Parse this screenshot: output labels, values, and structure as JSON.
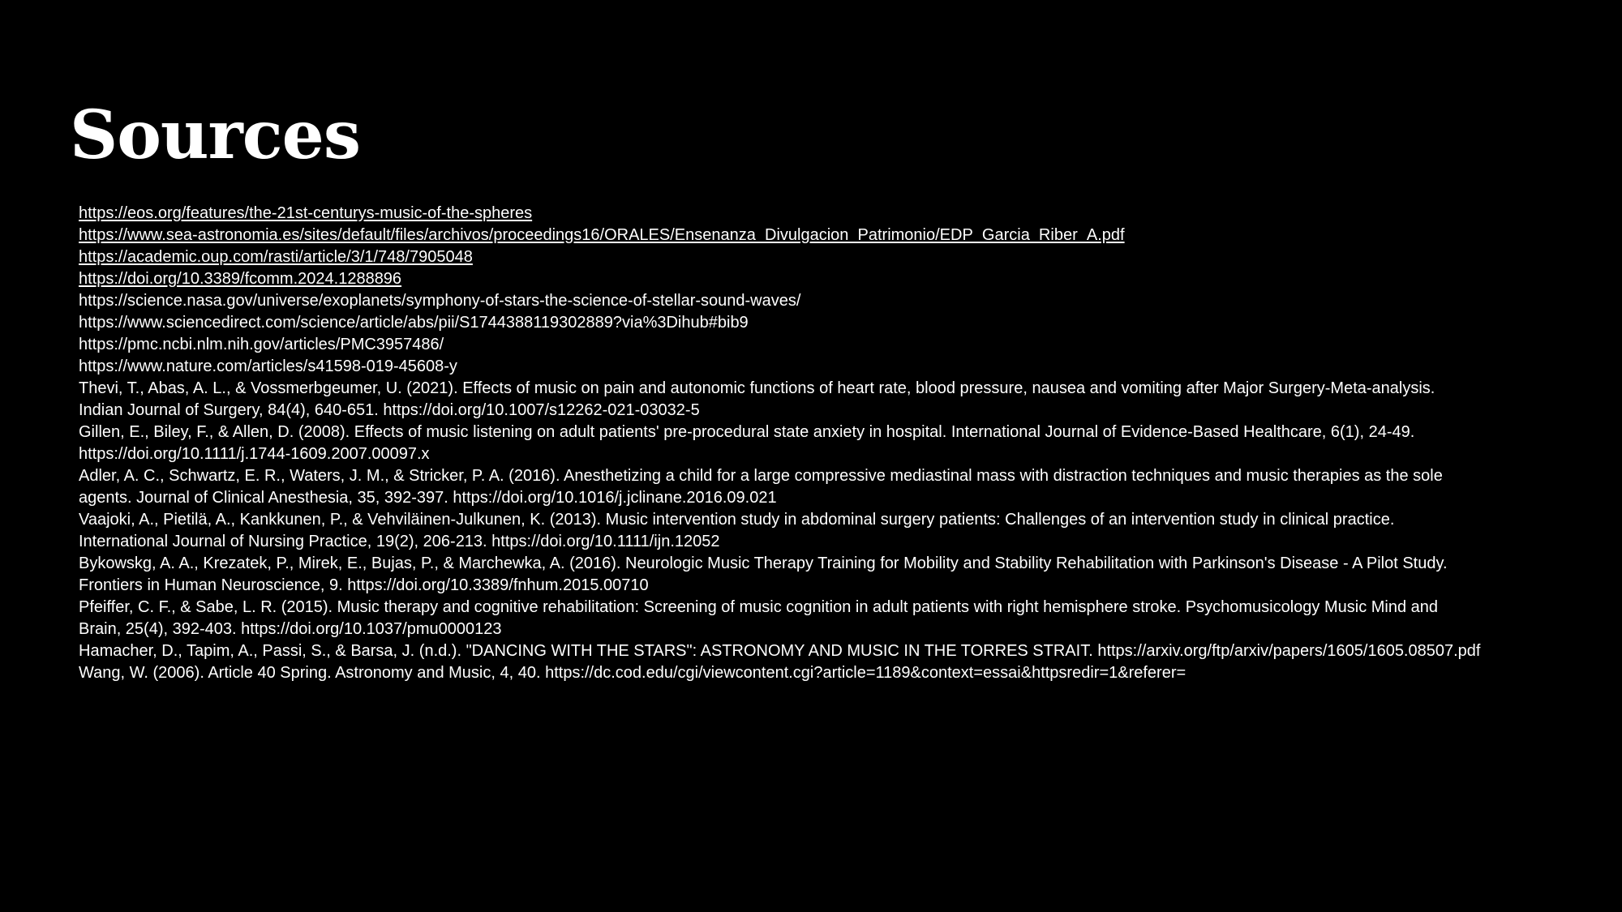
{
  "title": "Sources",
  "links": [
    "https://eos.org/features/the-21st-centurys-music-of-the-spheres",
    "https://www.sea-astronomia.es/sites/default/files/archivos/proceedings16/ORALES/Ensenanza_Divulgacion_Patrimonio/EDP_Garcia_Riber_A.pdf",
    "https://academic.oup.com/rasti/article/3/1/748/7905048",
    "https://doi.org/10.3389/fcomm.2024.1288896"
  ],
  "plain_urls": [
    "https://science.nasa.gov/universe/exoplanets/symphony-of-stars-the-science-of-stellar-sound-waves/",
    "https://www.sciencedirect.com/science/article/abs/pii/S1744388119302889?via%3Dihub#bib9",
    "https://pmc.ncbi.nlm.nih.gov/articles/PMC3957486/",
    "https://www.nature.com/articles/s41598-019-45608-y"
  ],
  "citations": [
    {
      "line1": "Thevi, T., Abas, A. L., & Vossmerbgeumer, U. (2021). Effects of music on pain and autonomic functions of heart rate, blood pressure, nausea and vomiting after Major Surgery-Meta-analysis.",
      "line2": "Indian Journal of Surgery, 84(4), 640-651. https://doi.org/10.1007/s12262-021-03032-5"
    },
    {
      "line1": "Gillen, E., Biley, F., & Allen, D. (2008). Effects of music listening on adult patients' pre-procedural state anxiety in hospital. International Journal of Evidence-Based Healthcare, 6(1), 24-49.",
      "line2": "https://doi.org/10.1111/j.1744-1609.2007.00097.x"
    },
    {
      "line1": "Adler, A. C., Schwartz, E. R., Waters, J. M., & Stricker, P. A. (2016). Anesthetizing a child for a large compressive mediastinal mass with distraction techniques and music therapies as the sole",
      "line2": "agents. Journal of Clinical Anesthesia, 35, 392-397. https://doi.org/10.1016/j.jclinane.2016.09.021"
    },
    {
      "line1": "Vaajoki, A., Pietilä, A., Kankkunen, P., & Vehviläinen-Julkunen, K. (2013). Music intervention study in abdominal surgery patients: Challenges of an intervention study in clinical practice.",
      "line2": "International Journal of Nursing Practice, 19(2), 206-213. https://doi.org/10.1111/ijn.12052"
    },
    {
      "line1": "Bykowskg, A. A., Krezatek, P., Mirek, E., Bujas, P., & Marchewka, A. (2016). Neurologic Music Therapy Training for Mobility and Stability Rehabilitation with Parkinson's Disease - A Pilot Study.",
      "line2": "Frontiers in Human Neuroscience, 9. https://doi.org/10.3389/fnhum.2015.00710"
    },
    {
      "line1": "Pfeiffer, C. F., & Sabe, L. R. (2015). Music therapy and cognitive rehabilitation: Screening of music cognition in adult patients with right hemisphere stroke. Psychomusicology Music Mind and",
      "line2": "Brain, 25(4), 392-403. https://doi.org/10.1037/pmu0000123"
    },
    {
      "line1": "Hamacher, D., Tapim, A., Passi, S., & Barsa, J. (n.d.). \"DANCING WITH THE STARS\": ASTRONOMY AND MUSIC IN THE TORRES STRAIT. https://arxiv.org/ftp/arxiv/papers/1605/1605.08507.pdf",
      "line2": ""
    },
    {
      "line1": "Wang, W. (2006). Article 40 Spring. Astronomy and Music, 4, 40. https://dc.cod.edu/cgi/viewcontent.cgi?article=1189&context=essai&httpsredir=1&referer=",
      "line2": ""
    }
  ]
}
